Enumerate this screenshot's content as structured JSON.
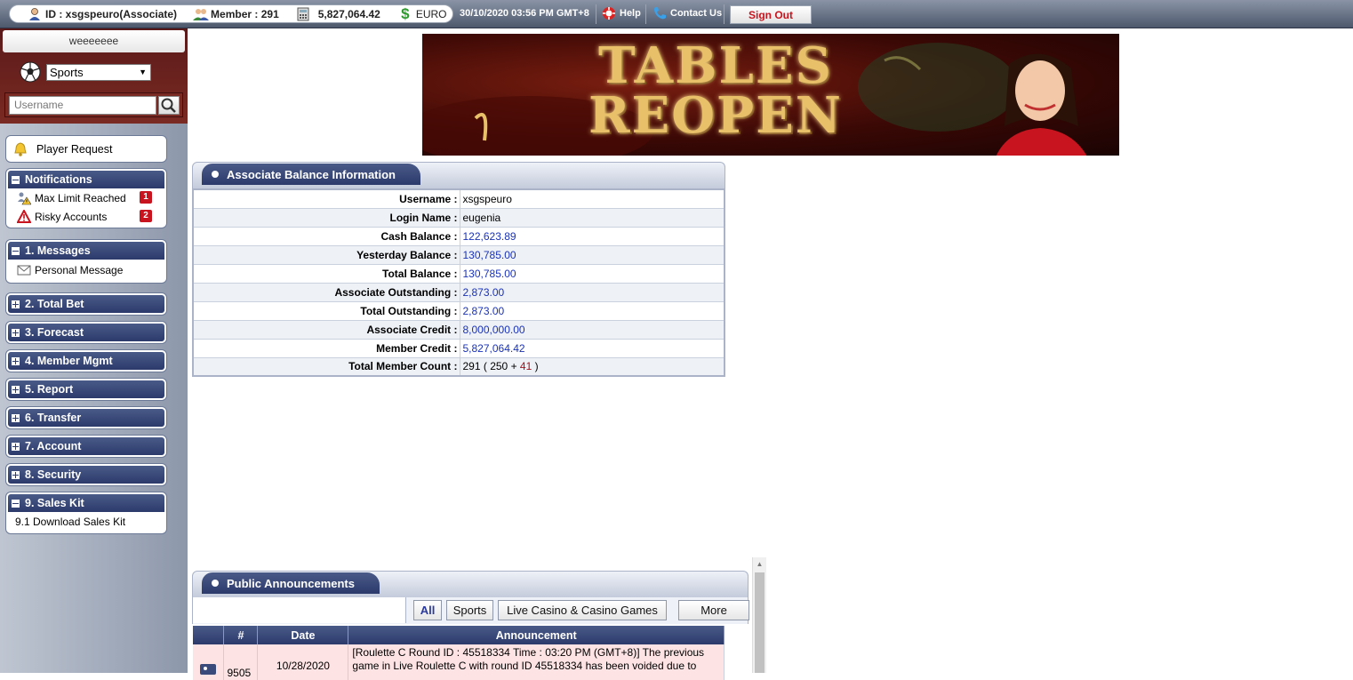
{
  "topbar": {
    "id_label": "ID : xsgspeuro(Associate)",
    "member_label": "Member : 291",
    "credit_value": "5,827,064.42",
    "currency": "EURO",
    "datetime": "30/10/2020 03:56 PM GMT+8",
    "help": "Help",
    "contact": "Contact Us",
    "signout": "Sign Out"
  },
  "sidebar": {
    "name": "weeeeeee",
    "product_selected": "Sports",
    "search_placeholder": "Username",
    "player_request": "Player Request",
    "notifications": {
      "title": "Notifications",
      "items": [
        {
          "label": "Max Limit Reached",
          "count": "1"
        },
        {
          "label": "Risky Accounts",
          "count": "2"
        }
      ]
    },
    "messages": {
      "title": "1. Messages",
      "items": [
        "Personal Message"
      ]
    },
    "menus": [
      "2. Total Bet",
      "3. Forecast",
      "4. Member Mgmt",
      "5. Report",
      "6. Transfer",
      "7. Account",
      "8. Security"
    ],
    "sales_kit": {
      "title": "9. Sales Kit",
      "items": [
        "9.1 Download Sales Kit"
      ]
    }
  },
  "banner": {
    "title_line1": "TABLES",
    "title_line2": "REOPEN"
  },
  "balance": {
    "title": "Associate Balance Information",
    "rows": [
      {
        "label": "Username :",
        "value": "xsgspeuro"
      },
      {
        "label": "Login Name :",
        "value": "eugenia"
      },
      {
        "label": "Cash Balance :",
        "value": "122,623.89"
      },
      {
        "label": "Yesterday Balance :",
        "value": "130,785.00"
      },
      {
        "label": "Total Balance :",
        "value": "130,785.00"
      },
      {
        "label": "Associate Outstanding :",
        "value": "2,873.00"
      },
      {
        "label": "Total Outstanding :",
        "value": "2,873.00"
      },
      {
        "label": "Associate Credit :",
        "value": "8,000,000.00"
      },
      {
        "label": "Member Credit :",
        "value": "5,827,064.42"
      },
      {
        "label": "Total Member Count :",
        "value_total": "291",
        "value_a": "250",
        "value_b": "41"
      }
    ]
  },
  "announcements": {
    "title": "Public Announcements",
    "filters": [
      "All",
      "Sports",
      "Live Casino & Casino Games",
      "More"
    ],
    "columns": [
      "#",
      "Date",
      "Announcement"
    ],
    "rows": [
      {
        "num": "9505",
        "date": "10/28/2020",
        "text": "[Roulette C Round ID : 45518334 Time : 03:20 PM (GMT+8)] The previous game in Live Roulette C with round ID 45518334 has been voided due to"
      }
    ]
  },
  "colors": {
    "nav_dark": "#2b3a6b",
    "link_blue": "#1a32b8",
    "signout_red": "#c8141e",
    "badge_red": "#c8141e"
  }
}
